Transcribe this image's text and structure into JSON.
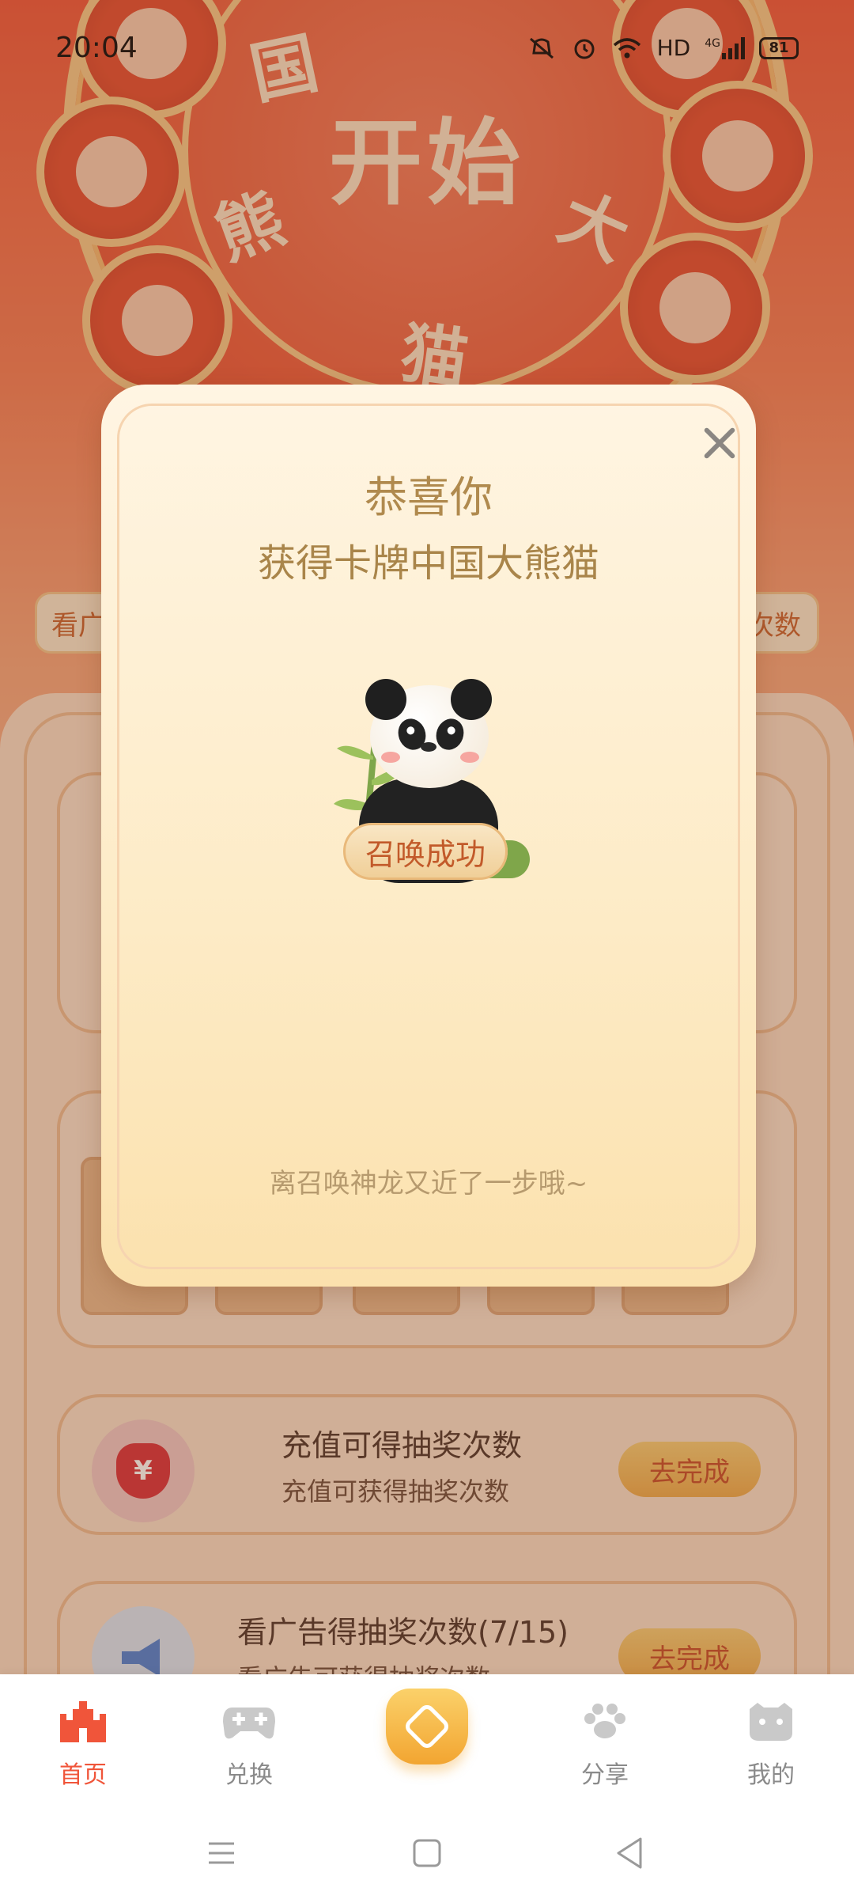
{
  "status_bar": {
    "time": "20:04",
    "network": "HD",
    "cell_type": "4G",
    "battery": "81",
    "icons": [
      "mute-icon",
      "alarm-icon",
      "wifi-icon",
      "signal-icon",
      "battery-icon"
    ]
  },
  "wheel": {
    "center_text": "开始",
    "chars": [
      "国",
      "熊",
      "猫",
      "大"
    ]
  },
  "background": {
    "left_pill_text": "看广",
    "right_pill_text": "次数"
  },
  "modal": {
    "title": "恭喜你",
    "subtitle": "获得卡牌中国大熊猫",
    "badge": "召唤成功",
    "footer": "离召唤神龙又近了一步哦~",
    "close_icon": "close-icon"
  },
  "tasks": [
    {
      "title": "充值可得抽奖次数",
      "desc": "充值可获得抽奖次数",
      "button": "去完成",
      "icon": "money-bag-icon",
      "icon_text": "¥"
    },
    {
      "title": "看广告得抽奖次数(7/15)",
      "desc": "看广告可获得抽奖次数",
      "button": "去完成",
      "icon": "megaphone-icon"
    }
  ],
  "tabbar": {
    "items": [
      {
        "label": "首页",
        "icon": "castle-icon",
        "active": true
      },
      {
        "label": "兑换",
        "icon": "gamepad-icon",
        "active": false
      },
      {
        "label": "",
        "icon": "money-bag-icon",
        "active": false
      },
      {
        "label": "分享",
        "icon": "paw-icon",
        "active": false
      },
      {
        "label": "我的",
        "icon": "face-icon",
        "active": false
      }
    ]
  },
  "colors": {
    "accent": "#f0553a",
    "modal_title": "#b08a4e",
    "button_text": "#c44a28"
  }
}
